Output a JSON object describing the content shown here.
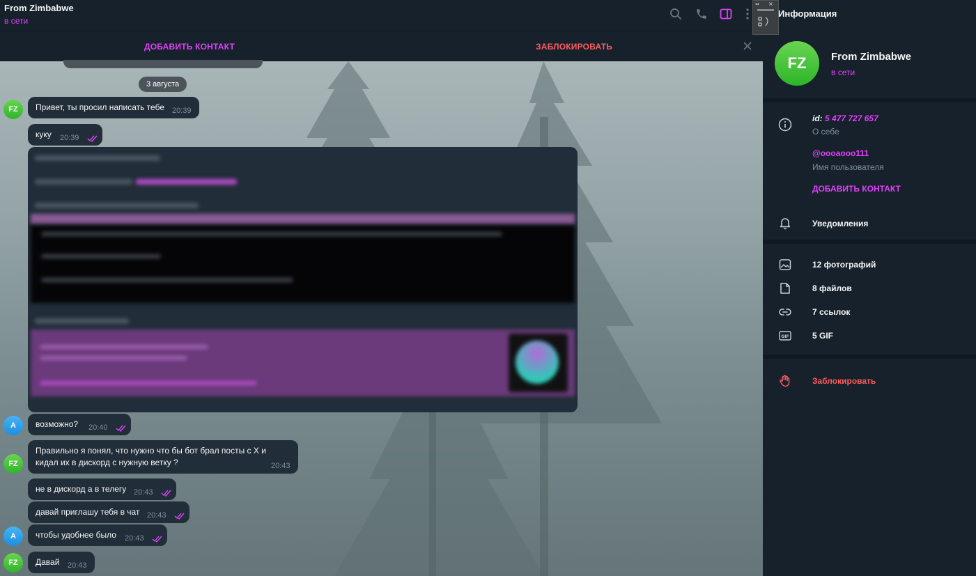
{
  "header": {
    "title": "From Zimbabwe",
    "status": "в сети",
    "icons": [
      "search-icon",
      "phone-icon",
      "sidebar-toggle-icon",
      "more-icon"
    ]
  },
  "action_bar": {
    "add_contact": "ДОБАВИТЬ КОНТАКТ",
    "block": "ЗАБЛОКИРОВАТЬ"
  },
  "chat": {
    "date_divider": "3 августа",
    "messages": [
      {
        "author": "FZ",
        "text": "Привет, ты просил написать тебе",
        "time": "20:39"
      },
      {
        "author": "FZ",
        "text": "куку",
        "time": "20:39",
        "read": true
      },
      {
        "author": "A",
        "text": "возможно?",
        "time": "20:40",
        "read": true
      },
      {
        "author": "FZ",
        "text": "Правильно я понял, что нужно что бы бот брал посты с X и кидал их в дискорд с нужную ветку ?",
        "time": "20:43"
      },
      {
        "author": "A",
        "text": "не в дискорд а в телегу",
        "time": "20:43",
        "read": true
      },
      {
        "author": "A",
        "text": "давай приглашу тебя в чат",
        "time": "20:43",
        "read": true
      },
      {
        "author": "A",
        "text": "чтобы удобнее было",
        "time": "20:43",
        "read": true
      },
      {
        "author": "FZ",
        "text": "Давай",
        "time": "20:43"
      }
    ],
    "avatars": {
      "fz": "FZ",
      "a": "A"
    }
  },
  "info_panel": {
    "title": "Информация",
    "avatar_initials": "FZ",
    "name": "From Zimbabwe",
    "status": "в сети",
    "id_prefix": "id:",
    "id_value": "5 477 727 657",
    "bio_label": "О себе",
    "username": "@oooaooo111",
    "username_label": "Имя пользователя",
    "add_contact": "ДОБАВИТЬ КОНТАКТ",
    "notifications": "Уведомления",
    "media": [
      {
        "icon": "photo-icon",
        "label": "12 фотографий"
      },
      {
        "icon": "file-icon",
        "label": "8 файлов"
      },
      {
        "icon": "link-icon",
        "label": "7 ссылок"
      },
      {
        "icon": "gif-icon",
        "label": "5 GIF"
      }
    ],
    "block": "Заблокировать"
  },
  "colors": {
    "accent": "#e040fb",
    "danger": "#ff5c5c",
    "panel": "#17212b",
    "bubble": "#212d38"
  }
}
